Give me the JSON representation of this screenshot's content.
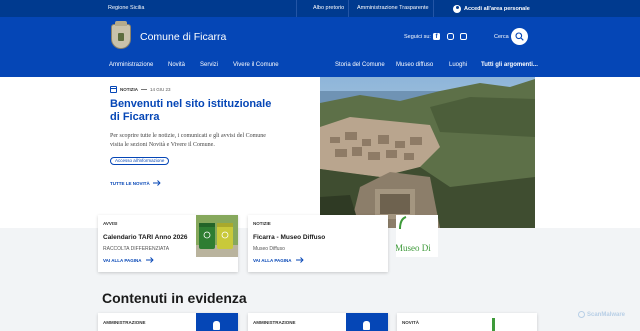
{
  "slimbar": {
    "region": "Regione Sicilia",
    "albo": "Albo pretorio",
    "trasparente": "Amministrazione Trasparente",
    "login": "Accedi all'area personale"
  },
  "header": {
    "title": "Comune di Ficarra",
    "social_label": "Seguici su:",
    "search_label": "Cerca",
    "nav_left": [
      "Amministrazione",
      "Novità",
      "Servizi",
      "Vivere il Comune"
    ],
    "nav_right": [
      "Storia del Comune",
      "Museo diffuso",
      "Luoghi",
      "Tutti gli argomenti..."
    ]
  },
  "hero": {
    "kind": "NOTIZIA",
    "date": "14 GIU 23",
    "title": "Benvenuti nel sito istituzionale di Ficarra",
    "text": "Per scoprire tutte le notizie, i comunicati e gli avvisi del Comune visita le sezioni Novità e Vivere il Comune.",
    "chip": "Accesso all'informazione",
    "read_all": "TUTTE LE NOVITÀ"
  },
  "cards": [
    {
      "cat": "AVVISI",
      "title": "Calendario TARI Anno 2026",
      "sub": "RACCOLTA DIFFERENZIATA",
      "go": "VAI ALLA PAGINA"
    },
    {
      "cat": "NOTIZIE",
      "title": "Ficarra - Museo Diffuso",
      "sub": "Museo Diffuso",
      "go": "VAI ALLA PAGINA",
      "thumb_text": "Museo Di"
    }
  ],
  "section": {
    "title": "Contenuti in evidenza",
    "cards": [
      "AMMINISTRAZIONE",
      "AMMINISTRAZIONE",
      "NOVITÀ"
    ]
  },
  "watermark": "ScanMalware",
  "colors": {
    "primary": "#0546b6",
    "slimbar": "#003a8f",
    "bins": "#7fa45a"
  }
}
